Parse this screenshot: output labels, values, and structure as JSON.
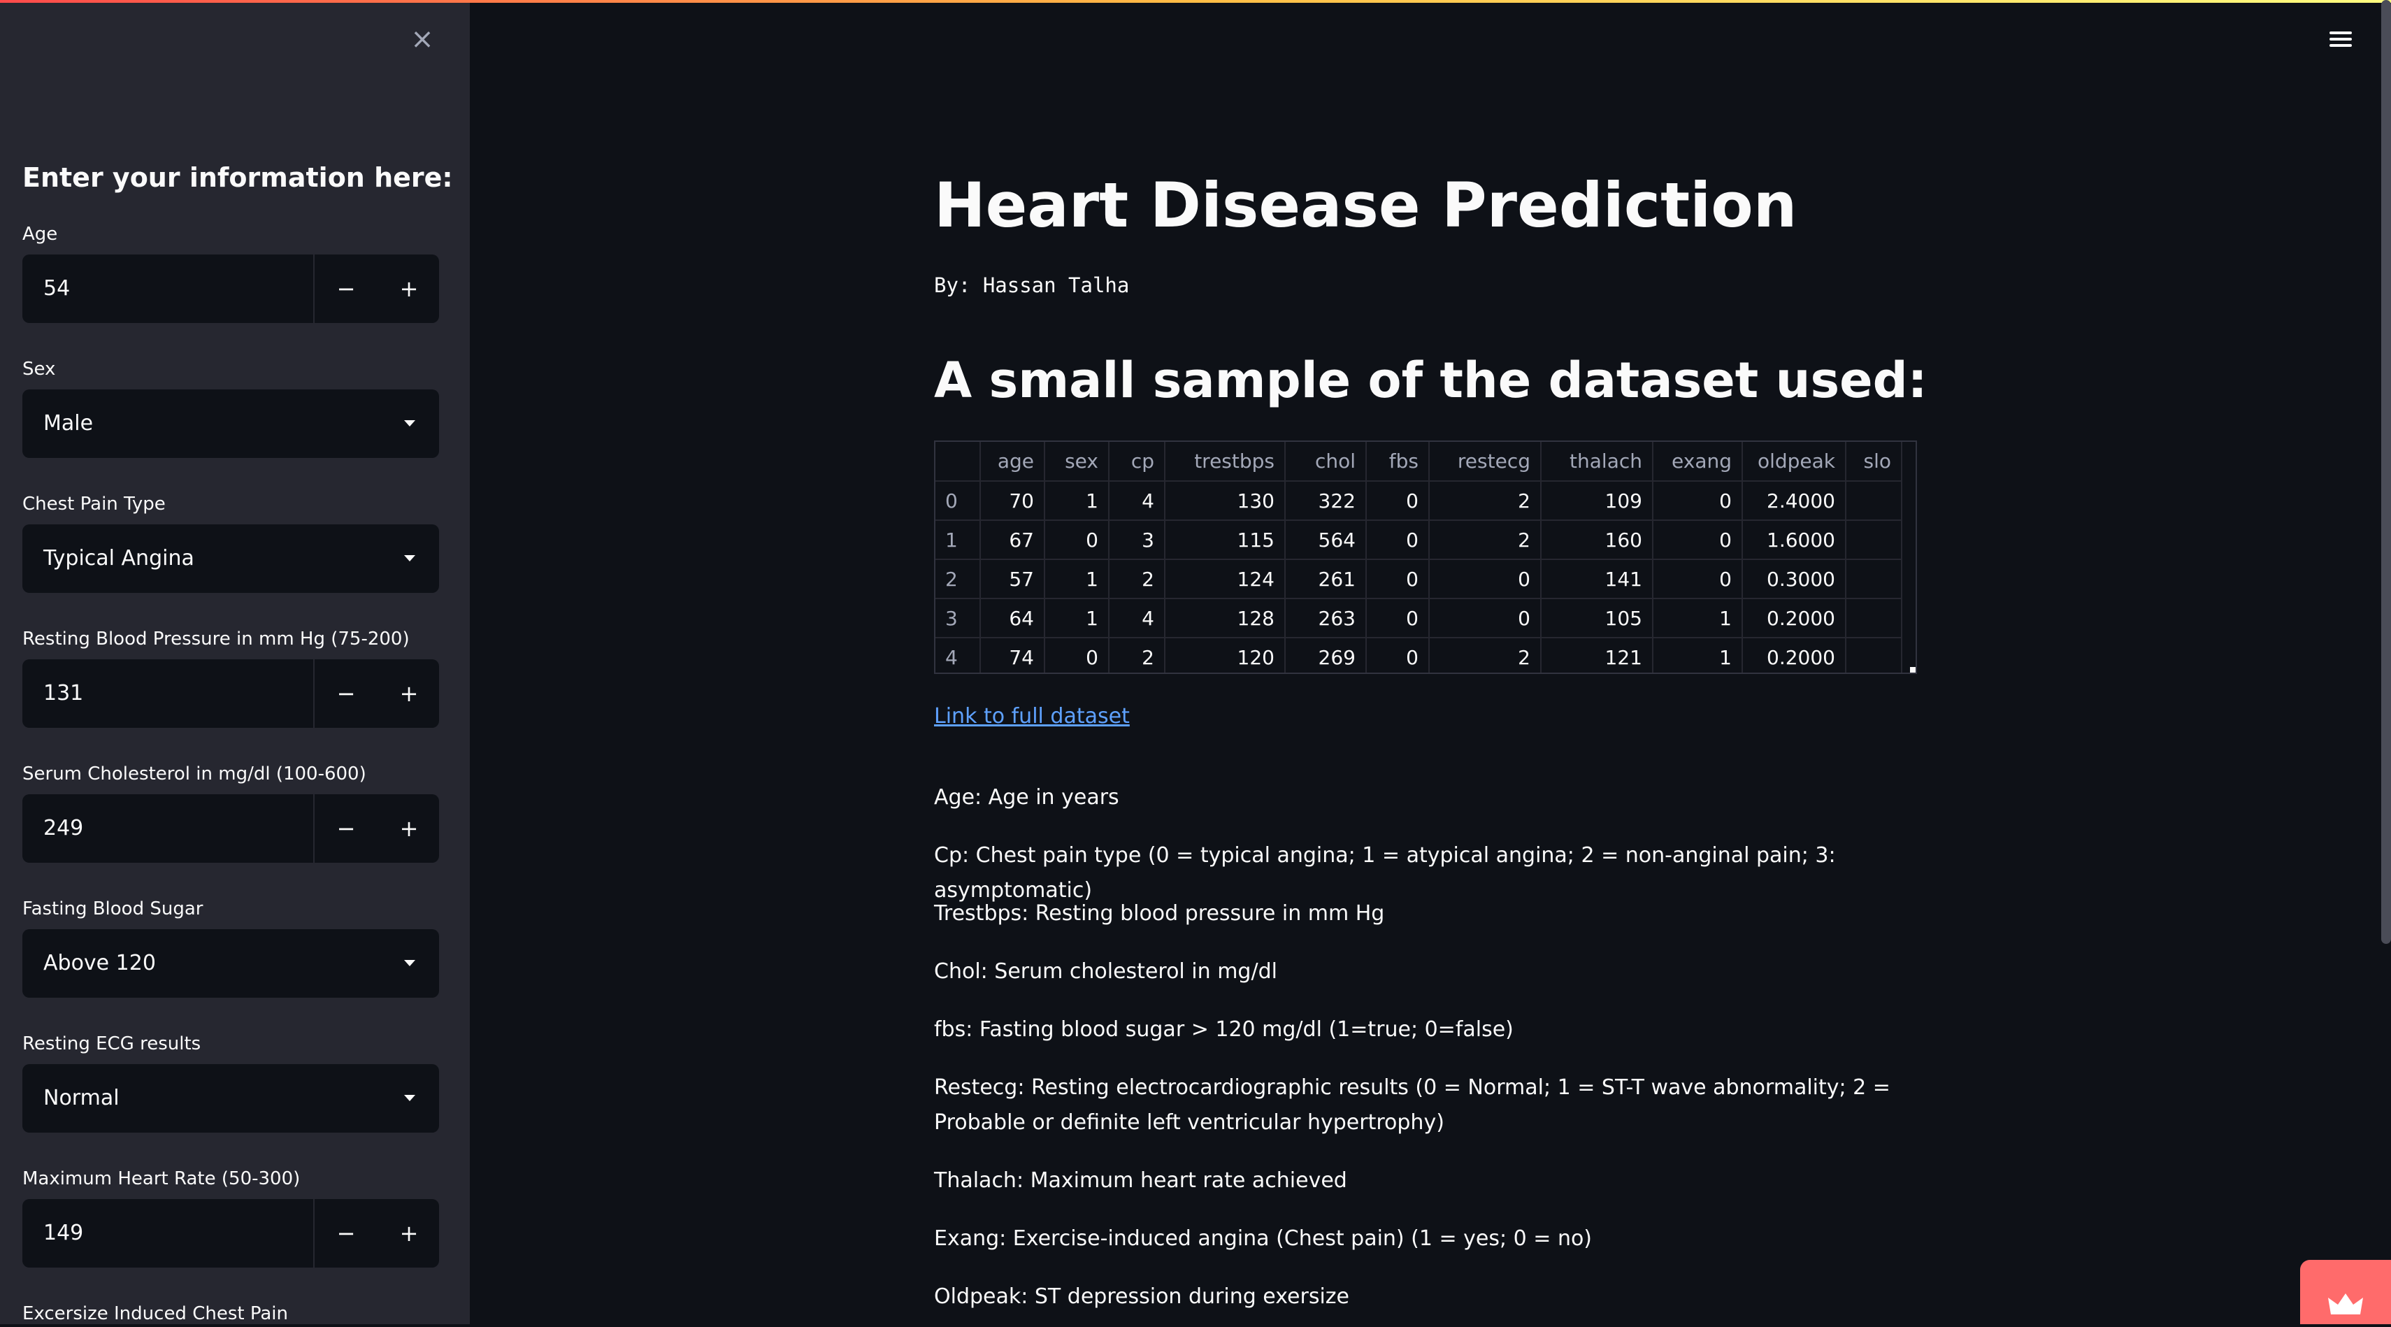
{
  "sidebar": {
    "heading": "Enter your information here:",
    "fields": [
      {
        "label": "Age",
        "value": "54",
        "kind": "number"
      },
      {
        "label": "Sex",
        "value": "Male",
        "kind": "select"
      },
      {
        "label": "Chest Pain Type",
        "value": "Typical Angina",
        "kind": "select"
      },
      {
        "label": "Resting Blood Pressure in mm Hg (75-200)",
        "value": "131",
        "kind": "number"
      },
      {
        "label": "Serum Cholesterol in mg/dl (100-600)",
        "value": "249",
        "kind": "number"
      },
      {
        "label": "Fasting Blood Sugar",
        "value": "Above 120",
        "kind": "select"
      },
      {
        "label": "Resting ECG results",
        "value": "Normal",
        "kind": "select"
      },
      {
        "label": "Maximum Heart Rate (50-300)",
        "value": "149",
        "kind": "number"
      },
      {
        "label": "Excersize Induced Chest Pain",
        "value": "",
        "kind": "select"
      }
    ],
    "minus_symbol": "−",
    "plus_symbol": "+",
    "close_symbol": "×"
  },
  "main": {
    "title": "Heart Disease Prediction",
    "byline": "By: Hassan Talha",
    "subtitle": "A small sample of the dataset used:",
    "table": {
      "columns": [
        "",
        "age",
        "sex",
        "cp",
        "trestbps",
        "chol",
        "fbs",
        "restecg",
        "thalach",
        "exang",
        "oldpeak",
        "slo"
      ],
      "rows": [
        [
          "0",
          "70",
          "1",
          "4",
          "130",
          "322",
          "0",
          "2",
          "109",
          "0",
          "2.4000",
          ""
        ],
        [
          "1",
          "67",
          "0",
          "3",
          "115",
          "564",
          "0",
          "2",
          "160",
          "0",
          "1.6000",
          ""
        ],
        [
          "2",
          "57",
          "1",
          "2",
          "124",
          "261",
          "0",
          "0",
          "141",
          "0",
          "0.3000",
          ""
        ],
        [
          "3",
          "64",
          "1",
          "4",
          "128",
          "263",
          "0",
          "0",
          "105",
          "1",
          "0.2000",
          ""
        ],
        [
          "4",
          "74",
          "0",
          "2",
          "120",
          "269",
          "0",
          "2",
          "121",
          "1",
          "0.2000",
          ""
        ]
      ]
    },
    "link_text": "Link to full dataset",
    "descriptions": [
      "Age: Age in years",
      "Cp: Chest pain type (0 = typical angina; 1 = atypical angina; 2 = non-anginal pain; 3: asymptomatic)",
      "Trestbps: Resting blood pressure in mm Hg",
      "Chol: Serum cholesterol in mg/dl",
      "fbs: Fasting blood sugar > 120 mg/dl (1=true; 0=false)",
      "Restecg: Resting electrocardiographic results (0 = Normal; 1 = ST-T wave abnormality; 2 = Probable or definite left ventricular hypertrophy)",
      "Thalach: Maximum heart rate achieved",
      "Exang: Exercise-induced angina (Chest pain) (1 = yes; 0 = no)",
      "Oldpeak: ST depression during exersize"
    ]
  },
  "colors": {
    "background": "#0e1117",
    "sidebar": "#262730",
    "accent": "#ff4b4b",
    "link": "#5ea1ff"
  },
  "icons": {
    "menu": "hamburger-icon",
    "close": "close-icon",
    "fab": "crown-icon"
  }
}
